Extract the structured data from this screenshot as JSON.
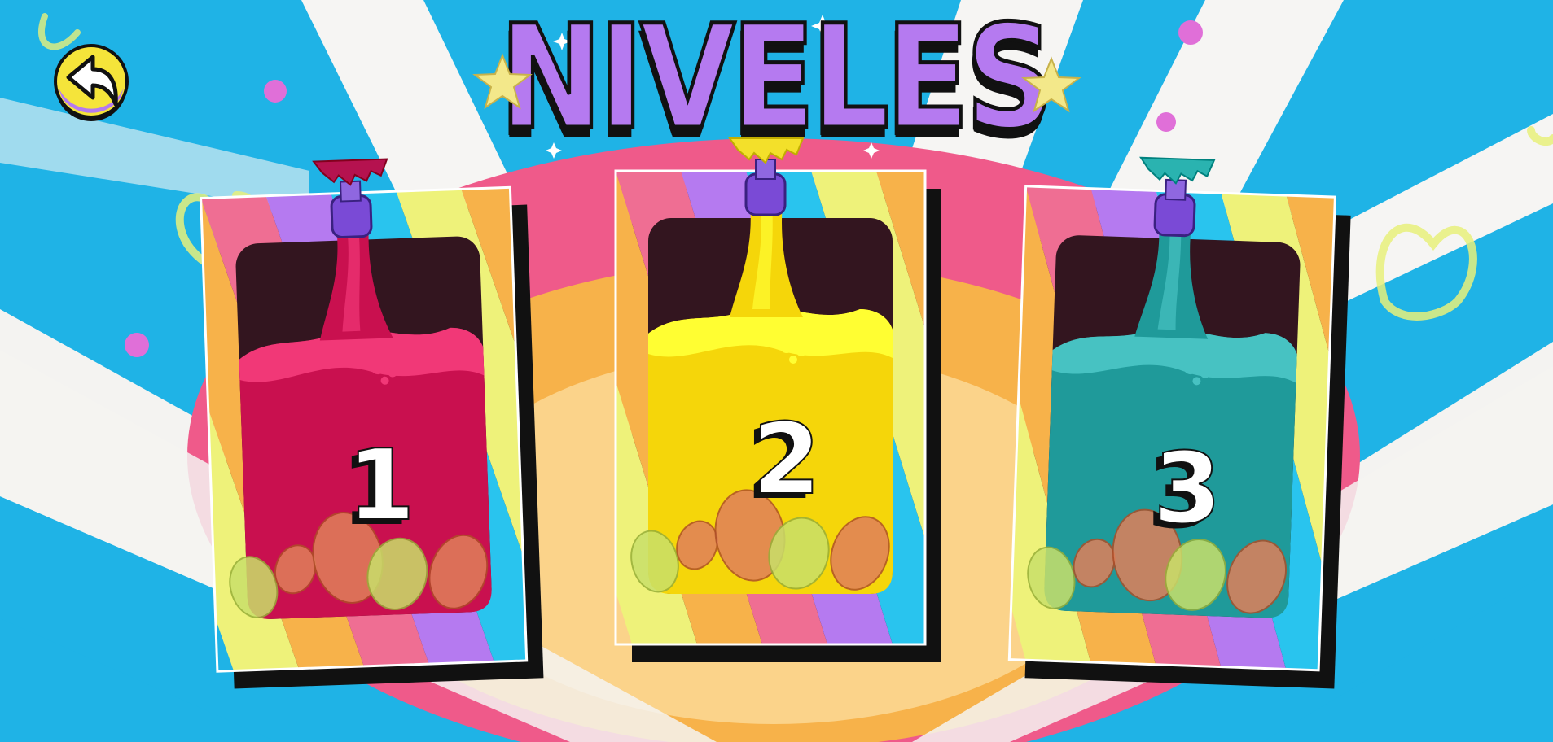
{
  "screen": {
    "title": "NIVELES",
    "background_colors": {
      "sky": "#1fb3e6",
      "ray": "#f6f4f3",
      "pink": "#ef5a8a",
      "orange": "#f7b24a"
    }
  },
  "back_button": {
    "icon": "back-arrow-icon",
    "colors": {
      "fill": "#f5e43a",
      "accent": "#b57af0",
      "outline": "#111111"
    }
  },
  "levels": [
    {
      "label": "1",
      "liquid_color": "#c9104f",
      "clip_color": "#b5124f"
    },
    {
      "label": "2",
      "liquid_color": "#f5d60a",
      "clip_color": "#f3e02a"
    },
    {
      "label": "3",
      "liquid_color": "#1f9a9a",
      "clip_color": "#2ab3b0"
    }
  ],
  "decorations": {
    "stars": "star-icon",
    "beans": "jelly-bean-icon",
    "hearts": "heart-doodle-icon"
  }
}
